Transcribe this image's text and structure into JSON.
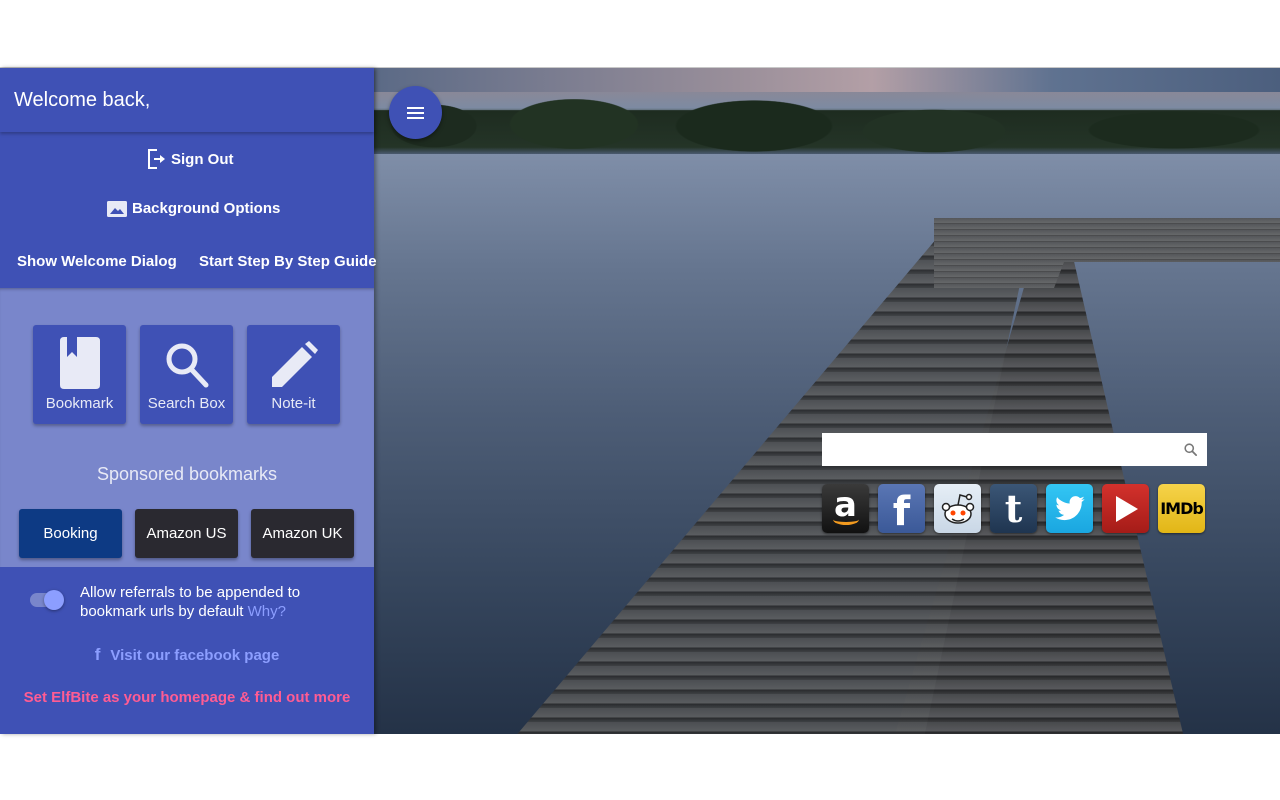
{
  "sidebar": {
    "welcome": "Welcome back,",
    "menu": {
      "sign_out": "Sign Out",
      "background_options": "Background Options",
      "show_welcome_dialog": "Show Welcome Dialog",
      "step_by_step_guide": "Start Step By Step Guide"
    },
    "tools": [
      {
        "label": "Bookmark",
        "icon": "bookmark-icon"
      },
      {
        "label": "Search Box",
        "icon": "search-icon"
      },
      {
        "label": "Note-it",
        "icon": "pencil-icon"
      }
    ],
    "sponsored_title": "Sponsored bookmarks",
    "sponsored": [
      {
        "label": "Booking",
        "color": "#0d3a84"
      },
      {
        "label": "Amazon US",
        "color": "#2a2930"
      },
      {
        "label": "Amazon UK",
        "color": "#2a2930"
      }
    ],
    "referral_toggle": {
      "text": "Allow referrals to be appended to bookmark urls by default",
      "why_link": "Why?",
      "enabled": true
    },
    "facebook_link": "Visit our facebook page",
    "homepage_link": "Set ElfBite as your homepage & find out more"
  },
  "search": {
    "value": "",
    "placeholder": ""
  },
  "quick_links": [
    {
      "name": "Amazon",
      "glyph": "a"
    },
    {
      "name": "Facebook",
      "glyph": "f"
    },
    {
      "name": "Reddit",
      "glyph": ""
    },
    {
      "name": "Tumblr",
      "glyph": "t"
    },
    {
      "name": "Twitter",
      "glyph": ""
    },
    {
      "name": "YouTube",
      "glyph": ""
    },
    {
      "name": "IMDb",
      "glyph": "IMDb"
    }
  ],
  "colors": {
    "primary": "#3f51b5",
    "primary_light": "#7986cb",
    "accent": "#8c9eff",
    "pink_link": "#ff5c93"
  }
}
